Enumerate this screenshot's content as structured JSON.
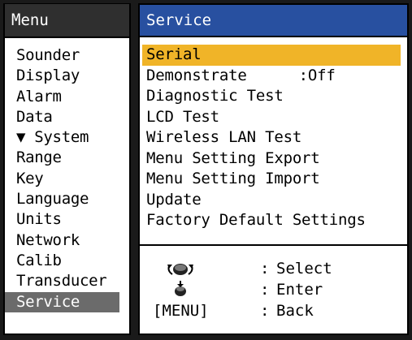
{
  "left_menu": {
    "title": "Menu",
    "items": [
      {
        "label": "Sounder"
      },
      {
        "label": "Display"
      },
      {
        "label": "Alarm"
      },
      {
        "label": "Data"
      },
      {
        "label": "▼ System"
      },
      {
        "label": "Range"
      },
      {
        "label": "Key"
      },
      {
        "label": "Language"
      },
      {
        "label": "Units"
      },
      {
        "label": "Network"
      },
      {
        "label": "Calib"
      },
      {
        "label": "Transducer"
      },
      {
        "label": "Service",
        "selected": true
      }
    ]
  },
  "service_menu": {
    "title": "Service",
    "items": [
      {
        "label": "Serial",
        "selected": true
      },
      {
        "label": "Demonstrate",
        "value": ":Off"
      },
      {
        "label": "Diagnostic Test"
      },
      {
        "label": "LCD Test"
      },
      {
        "label": "Wireless LAN Test"
      },
      {
        "label": "Menu Setting Export"
      },
      {
        "label": "Menu Setting Import"
      },
      {
        "label": "Update"
      },
      {
        "label": "Factory Default Settings"
      }
    ]
  },
  "legend": {
    "select": {
      "icon": "rotary-knob-icon",
      "sep": ":",
      "desc": "Select"
    },
    "enter": {
      "icon": "knob-press-icon",
      "sep": ":",
      "desc": "Enter"
    },
    "back": {
      "key": "[MENU]",
      "sep": ":",
      "desc": "Back"
    }
  },
  "colors": {
    "left_title_bg": "#2f2f2f",
    "right_title_bg": "#2850a0",
    "selected_left_bg": "#6b6b6b",
    "selected_right_bg": "#f0b428"
  }
}
